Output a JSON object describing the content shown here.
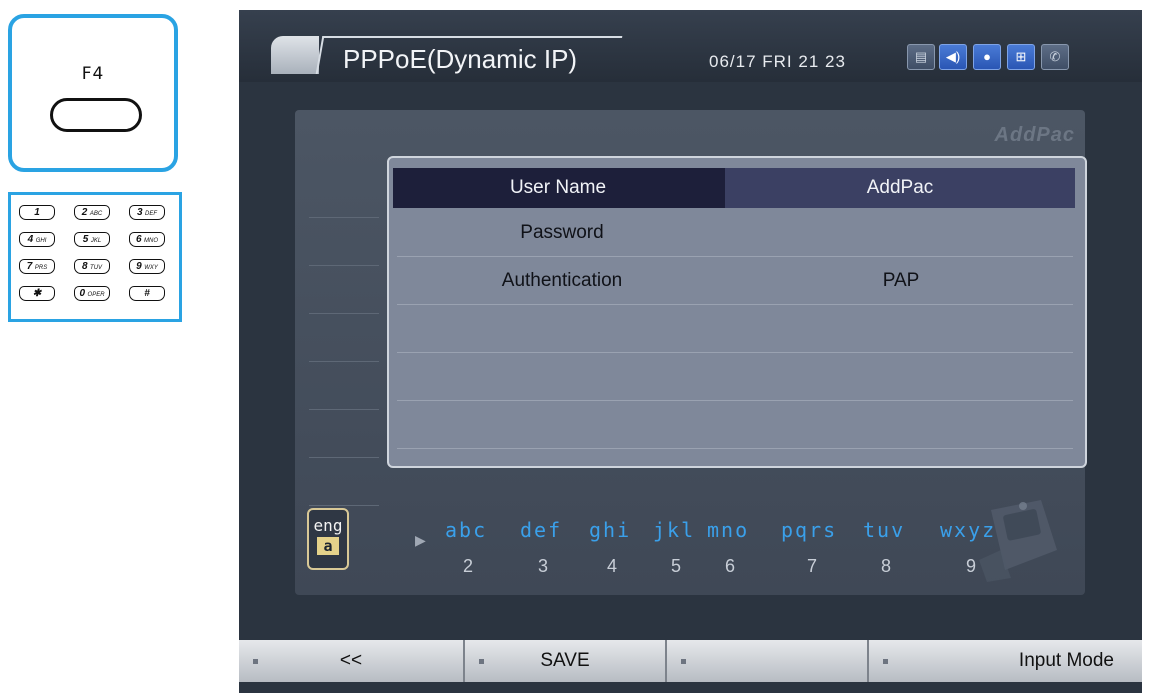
{
  "fkey": {
    "label": "F4"
  },
  "keypad": {
    "keys": [
      {
        "digit": "1",
        "sub": ""
      },
      {
        "digit": "2",
        "sub": "ABC"
      },
      {
        "digit": "3",
        "sub": "DEF"
      },
      {
        "digit": "4",
        "sub": "GHI"
      },
      {
        "digit": "5",
        "sub": "JKL"
      },
      {
        "digit": "6",
        "sub": "MNO"
      },
      {
        "digit": "7",
        "sub": "PRS"
      },
      {
        "digit": "8",
        "sub": "TUV"
      },
      {
        "digit": "9",
        "sub": "WXY"
      },
      {
        "digit": "✱",
        "sub": ""
      },
      {
        "digit": "0",
        "sub": "OPER"
      },
      {
        "digit": "#",
        "sub": ""
      }
    ]
  },
  "header": {
    "title": "PPPoE(Dynamic IP)",
    "datetime": "06/17 FRI 21 23",
    "status_icons": [
      "on-air-icon",
      "speaker-icon",
      "user-icon",
      "network-icon",
      "handset-icon"
    ]
  },
  "brand": "AddPac",
  "form": {
    "rows": [
      {
        "label": "User Name",
        "value": "AddPac",
        "selected": true
      },
      {
        "label": "Password",
        "value": ""
      },
      {
        "label": "Authentication",
        "value": "PAP"
      },
      {
        "label": "",
        "value": ""
      },
      {
        "label": "",
        "value": ""
      },
      {
        "label": "",
        "value": ""
      }
    ]
  },
  "ime": {
    "lang": "eng",
    "case": "a",
    "groups": [
      {
        "letters": "abc",
        "num": "2"
      },
      {
        "letters": "def",
        "num": "3"
      },
      {
        "letters": "ghi",
        "num": "4"
      },
      {
        "letters": "jkl",
        "num": "5"
      },
      {
        "letters": "mno",
        "num": "6"
      },
      {
        "letters": "pqrs",
        "num": "7"
      },
      {
        "letters": "tuv",
        "num": "8"
      },
      {
        "letters": "wxyz",
        "num": "9"
      }
    ]
  },
  "softkeys": [
    "<<",
    "SAVE",
    "",
    "Input Mode"
  ],
  "colors": {
    "accent_blue": "#2aa3e3",
    "ime_letter": "#3aa0ea",
    "selected_row": "#1d1f3a"
  }
}
